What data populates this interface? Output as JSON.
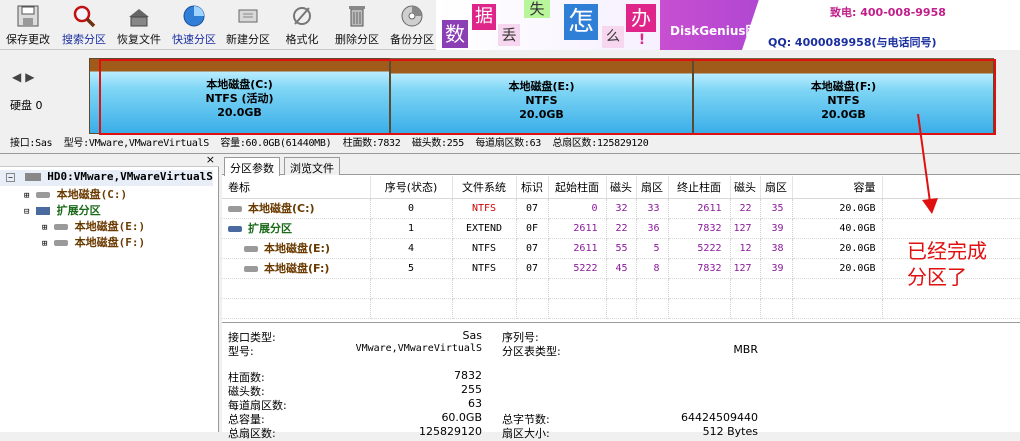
{
  "toolbar": {
    "buttons": [
      {
        "label": "保存更改",
        "icon": "save-icon"
      },
      {
        "label": "搜索分区",
        "icon": "search-icon"
      },
      {
        "label": "恢复文件",
        "icon": "recover-file-icon"
      },
      {
        "label": "快速分区",
        "icon": "quick-partition-icon"
      },
      {
        "label": "新建分区",
        "icon": "new-partition-icon"
      },
      {
        "label": "格式化",
        "icon": "format-icon"
      },
      {
        "label": "删除分区",
        "icon": "delete-icon"
      },
      {
        "label": "备份分区",
        "icon": "backup-icon"
      }
    ]
  },
  "banner": {
    "chars": [
      "数",
      "据",
      "丢",
      "失",
      "怎",
      "么",
      "办",
      "!"
    ],
    "brand": "DiskGenius团队为您服务",
    "phone": "致电: 400-008-9958",
    "qq": "QQ: 4000089958(与电话同号)"
  },
  "disk": {
    "label": "硬盘 0",
    "info": "接口:Sas  型号:VMware,VMwareVirtualS  容量:60.0GB(61440MB)  柱面数:7832  磁头数:255  每道扇区数:63  总扇区数:125829120"
  },
  "partitions": [
    {
      "name": "本地磁盘(C:)",
      "fs": "NTFS (活动)",
      "size": "20.0GB"
    },
    {
      "name": "本地磁盘(E:)",
      "fs": "NTFS",
      "size": "20.0GB"
    },
    {
      "name": "本地磁盘(F:)",
      "fs": "NTFS",
      "size": "20.0GB"
    }
  ],
  "tree": {
    "root": "HD0:VMware,VMwareVirtualS",
    "items": [
      "本地磁盘(C:)",
      "扩展分区",
      "本地磁盘(E:)",
      "本地磁盘(F:)"
    ]
  },
  "tabs": [
    "分区参数",
    "浏览文件"
  ],
  "table": {
    "headers": [
      "卷标",
      "序号(状态)",
      "文件系统",
      "标识",
      "起始柱面",
      "磁头",
      "扇区",
      "终止柱面",
      "磁头",
      "扇区",
      "容量"
    ],
    "rows": [
      [
        "本地磁盘(C:)",
        "0",
        "NTFS",
        "07",
        "0",
        "32",
        "33",
        "2611",
        "22",
        "35",
        "20.0GB"
      ],
      [
        "扩展分区",
        "1",
        "EXTEND",
        "0F",
        "2611",
        "22",
        "36",
        "7832",
        "127",
        "39",
        "40.0GB"
      ],
      [
        "本地磁盘(E:)",
        "4",
        "NTFS",
        "07",
        "2611",
        "55",
        "5",
        "5222",
        "12",
        "38",
        "20.0GB"
      ],
      [
        "本地磁盘(F:)",
        "5",
        "NTFS",
        "07",
        "5222",
        "45",
        "8",
        "7832",
        "127",
        "39",
        "20.0GB"
      ]
    ]
  },
  "details": {
    "iface_label": "接口类型:",
    "iface": "Sas",
    "model_label": "型号:",
    "model": "VMware,VMwareVirtualS",
    "serial_label": "序列号:",
    "serial": "",
    "ptype_label": "分区表类型:",
    "ptype": "MBR",
    "cyl_label": "柱面数:",
    "cyl": "7832",
    "heads_label": "磁头数:",
    "heads": "255",
    "spt_label": "每道扇区数:",
    "spt": "63",
    "cap_label": "总容量:",
    "cap": "60.0GB",
    "bytes_label": "总字节数:",
    "bytes": "64424509440",
    "sectors_label": "总扇区数:",
    "sectors": "125829120",
    "secsize_label": "扇区大小:",
    "secsize": "512 Bytes"
  },
  "annotation": "已经完成\n分区了",
  "colors": {
    "accent": "#e01010",
    "partition_fill": "#3aaee8",
    "partition_name": "#6b3a00",
    "purple_num": "#8a1a9a",
    "red_fs": "#cc0000"
  }
}
